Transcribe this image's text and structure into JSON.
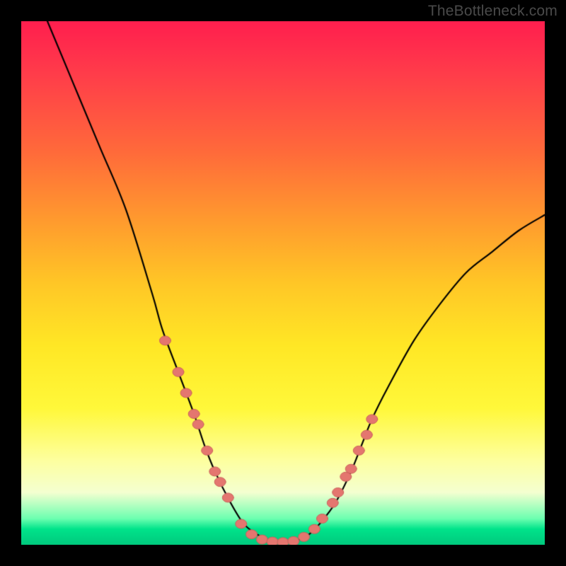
{
  "watermark": "TheBottleneck.com",
  "colors": {
    "page_bg": "#000000",
    "curve": "#000000",
    "dot_fill": "#e4766f",
    "dot_stroke": "#c9605a",
    "gradient_stops": [
      "#ff1e4e",
      "#ff3c4a",
      "#ff6a3a",
      "#ff9a2e",
      "#ffc626",
      "#ffe725",
      "#fff83a",
      "#fdffa0",
      "#f4ffd0",
      "#6cffb0",
      "#00e38a",
      "#00c97d"
    ]
  },
  "chart_data": {
    "type": "line",
    "title": "",
    "xlabel": "",
    "ylabel": "",
    "xlim": [
      0,
      100
    ],
    "ylim": [
      0,
      100
    ],
    "y_axis_inverted_note": "y=0 at bottom (green) means best/0% bottleneck; y=100 at top (red) means worst",
    "series": [
      {
        "name": "bottleneck-curve",
        "x": [
          5,
          10,
          15,
          20,
          25,
          27,
          30,
          33,
          35,
          37,
          40,
          42.5,
          45,
          47,
          49,
          51,
          53,
          55,
          57,
          60,
          63,
          65,
          67,
          70,
          75,
          80,
          85,
          90,
          95,
          100
        ],
        "y": [
          100,
          88,
          76,
          64,
          48,
          41,
          33,
          25,
          19,
          14,
          8,
          4,
          2,
          1,
          0.5,
          0.5,
          1,
          2,
          4,
          8,
          14,
          19,
          24,
          30,
          39,
          46,
          52,
          56,
          60,
          63
        ]
      }
    ],
    "scatter_points": {
      "name": "highlighted-samples",
      "x": [
        27.5,
        30,
        31.5,
        33,
        33.8,
        35.5,
        37,
        38,
        39.5,
        42,
        44,
        46,
        48,
        50,
        52,
        54,
        56,
        57.5,
        59.5,
        60.5,
        62,
        63,
        64.5,
        66,
        67
      ],
      "y": [
        39,
        33,
        29,
        25,
        23,
        18,
        14,
        12,
        9,
        4,
        2,
        1,
        0.6,
        0.5,
        0.7,
        1.5,
        3,
        5,
        8,
        10,
        13,
        14.5,
        18,
        21,
        24
      ]
    }
  }
}
